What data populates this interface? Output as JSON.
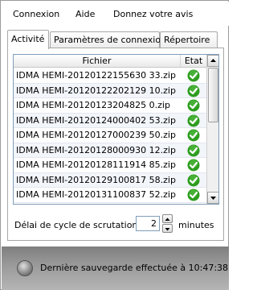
{
  "menu": {
    "items": [
      "Connexion",
      "Aide",
      "Donnez votre avis"
    ]
  },
  "tabs": [
    {
      "label": "Activité",
      "active": true
    },
    {
      "label": "Paramètres de connexion",
      "active": false
    },
    {
      "label": "Répertoire",
      "active": false
    }
  ],
  "file_list": {
    "columns": [
      "Fichier",
      "Etat"
    ],
    "rows": [
      {
        "file": "IDMA HEMI-20120122155630 33.zip",
        "status": "check-icon"
      },
      {
        "file": "IDMA HEMI-20120122202129 10.zip",
        "status": "check-icon"
      },
      {
        "file": "IDMA HEMI-20120123204825 0.zip",
        "status": "check-icon"
      },
      {
        "file": "IDMA HEMI-20120124000402 53.zip",
        "status": "check-icon"
      },
      {
        "file": "IDMA HEMI-20120127000239 50.zip",
        "status": "check-icon"
      },
      {
        "file": "IDMA HEMI-20120128000930 12.zip",
        "status": "check-icon"
      },
      {
        "file": "IDMA HEMI-20120128111914 85.zip",
        "status": "check-icon"
      },
      {
        "file": "IDMA HEMI-20120129100817 58.zip",
        "status": "check-icon"
      },
      {
        "file": "IDMA HEMI-20120131100837 52.zip",
        "status": "check-icon"
      }
    ]
  },
  "polling": {
    "label": "Délai de cycle de scrutation",
    "value": "2",
    "unit": "minutes"
  },
  "statusbar": {
    "text": "Dernière sauvegarde effectuée à 10:47:38"
  },
  "colors": {
    "check_green": "#2e9c1f",
    "row_alt": "#f2f5fa",
    "statusbar_top": "#7f7f7f",
    "statusbar_bottom": "#b5b5b5"
  }
}
